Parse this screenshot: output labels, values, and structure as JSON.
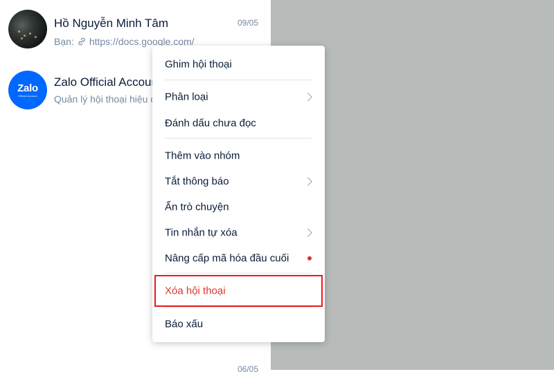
{
  "conversations": [
    {
      "name": "Hồ Nguyễn Minh Tâm",
      "date": "09/05",
      "preview_prefix": "Bạn:",
      "preview_icon": "link-icon",
      "preview_text": "https://docs.google.com/"
    },
    {
      "name": "Zalo Official Account",
      "avatar_logo": "Zalo",
      "avatar_sub": "Official Account",
      "preview_text": "Quản lý hội thoại hiệu quả"
    }
  ],
  "bottom_date": "06/05",
  "context_menu": {
    "items": {
      "pin": "Ghim hội thoại",
      "classify": "Phân loại",
      "mark_unread": "Đánh dấu chưa đọc",
      "add_to_group": "Thêm vào nhóm",
      "mute": "Tắt thông báo",
      "hide": "Ẩn trò chuyện",
      "auto_delete": "Tin nhắn tự xóa",
      "e2ee": "Nâng cấp mã hóa đầu cuối",
      "delete": "Xóa hội thoại",
      "report": "Báo xấu"
    }
  },
  "colors": {
    "accent": "#0068ff",
    "danger": "#db342e",
    "highlight_border": "#e8191c",
    "overlay_panel": "#b7bbb9"
  }
}
